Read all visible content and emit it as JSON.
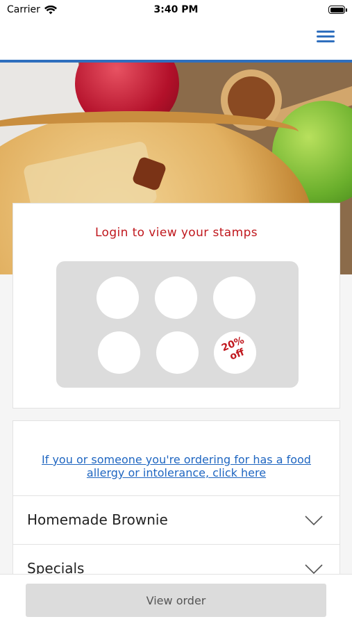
{
  "status_bar": {
    "carrier": "Carrier",
    "time": "3:40 PM"
  },
  "header": {
    "menu_icon": "hamburger-menu-icon",
    "accent_color": "#2f6fbe"
  },
  "stamps": {
    "title": "Login to view your stamps",
    "total_slots": 6,
    "reward_label_line1": "20%",
    "reward_label_line2": "off",
    "accent_color": "#c0171d"
  },
  "allergy": {
    "link_text": "If you or someone you're ordering for has a food allergy or intolerance, click here"
  },
  "categories": [
    {
      "label": "Homemade Brownie"
    },
    {
      "label": "Specials"
    }
  ],
  "bottom_bar": {
    "view_order_label": "View order"
  }
}
